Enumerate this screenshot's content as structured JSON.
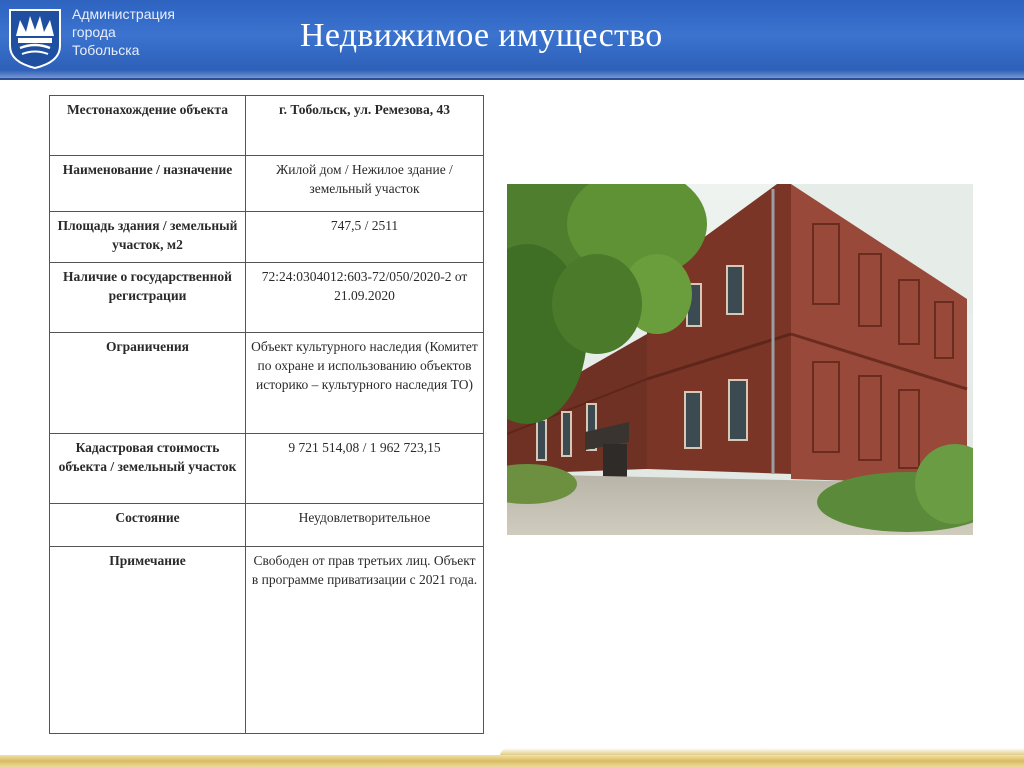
{
  "header": {
    "org_line1": "Администрация",
    "org_line2": "города",
    "org_line3": "Тобольска",
    "title": "Недвижимое имущество"
  },
  "property_table": {
    "rows": [
      {
        "label": "Местонахождение объекта",
        "value": "г. Тобольск, ул. Ремезова, 43"
      },
      {
        "label": "Наименование / назначение",
        "value": "Жилой дом / Нежилое здание / земельный участок"
      },
      {
        "label": "Площадь здания / земельный участок, м2",
        "value": "747,5 / 2511"
      },
      {
        "label": "Наличие о государственной регистрации",
        "value": "72:24:0304012:603-72/050/2020-2 от 21.09.2020"
      },
      {
        "label": "Ограничения",
        "value": "Объект культурного наследия (Комитет по охране и использованию объектов историко – культурного наследия ТО)"
      },
      {
        "label": "Кадастровая стоимость объекта / земельный участок",
        "value": "9 721 514,08 / 1 962 723,15"
      },
      {
        "label": "Состояние",
        "value": "Неудовлетворительное"
      },
      {
        "label": "Примечание",
        "value": "Свободен от прав третьих лиц. Объект в программе приватизации с 2021 года."
      }
    ]
  },
  "colors": {
    "header_blue": "#3b73cf",
    "brick": "#8c3f2e",
    "footer_gold": "#d9bb62"
  }
}
